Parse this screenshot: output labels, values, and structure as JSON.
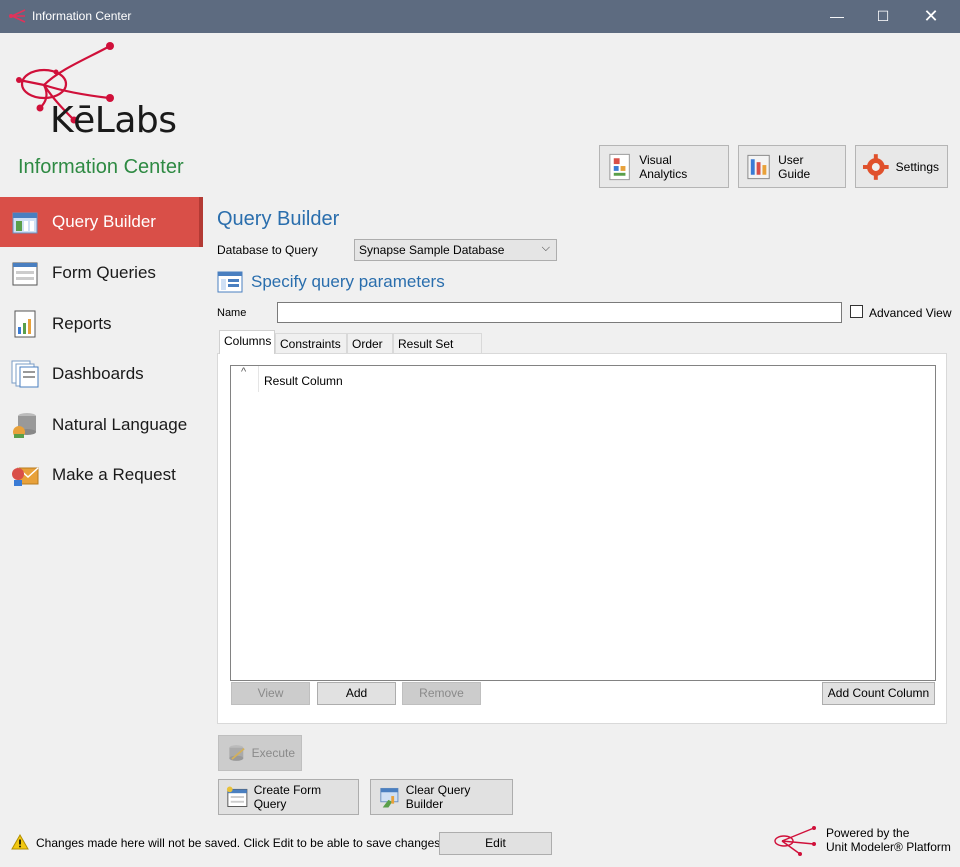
{
  "window": {
    "title": "Information Center",
    "controls": [
      "—",
      "☐",
      "✕"
    ]
  },
  "brand": {
    "logo_text": "KēLabs",
    "app_title": "Information Center"
  },
  "toolbar": {
    "visual_analytics": "Visual Analytics",
    "user_guide": "User Guide",
    "settings": "Settings"
  },
  "sidebar": {
    "items": [
      {
        "label": "Query Builder",
        "icon": "query-builder-icon",
        "active": true
      },
      {
        "label": "Form Queries",
        "icon": "form-queries-icon"
      },
      {
        "label": "Reports",
        "icon": "reports-icon"
      },
      {
        "label": "Dashboards",
        "icon": "dashboards-icon"
      },
      {
        "label": "Natural Language",
        "icon": "natural-language-icon"
      },
      {
        "label": "Make a Request",
        "icon": "make-request-icon"
      }
    ]
  },
  "main": {
    "title": "Query Builder",
    "db_label": "Database to Query",
    "db_value": "Synapse Sample Database",
    "params_title": "Specify query parameters",
    "name_label": "Name",
    "name_value": "",
    "advanced_view": "Advanced View",
    "tabs": [
      "Columns",
      "Constraints",
      "Order",
      "Result Set Size"
    ],
    "grid": {
      "column_header": "Result Column",
      "sort_glyph": "^"
    },
    "grid_buttons": {
      "view": "View",
      "add": "Add",
      "remove": "Remove",
      "add_count": "Add Count Column"
    },
    "execute": "Execute",
    "create_form_query": "Create Form Query",
    "clear_query_builder": "Clear Query Builder"
  },
  "status": {
    "warning": "Changes made here will not be saved. Click Edit to be able to save changes.",
    "edit": "Edit",
    "powered_line1": "Powered by the",
    "powered_line2": "Unit Modeler® Platform"
  },
  "colors": {
    "titlebar": "#5d6b80",
    "active_nav": "#d94f48",
    "accent_blue": "#2a6ead",
    "brand_green": "#2e8a43",
    "logo_red": "#d0103a"
  }
}
